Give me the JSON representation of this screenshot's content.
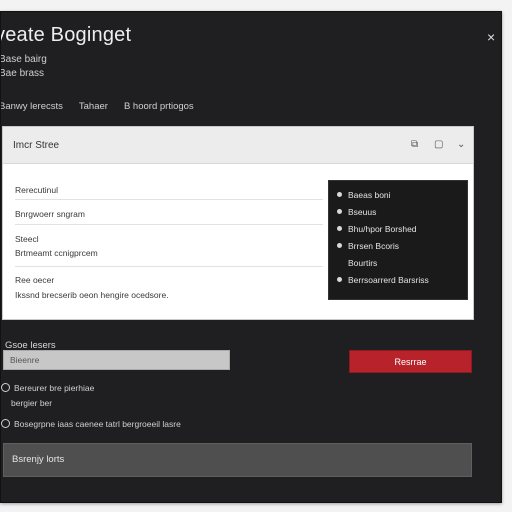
{
  "dialog": {
    "title": "veate Boginget",
    "subtitle_1": "Base bairg",
    "subtitle_2": "Bae brass",
    "close_glyph": "×"
  },
  "tabs": [
    {
      "label": "Banwy lerecsts"
    },
    {
      "label": "Tahaer"
    },
    {
      "label": "B hoord prtiogos"
    }
  ],
  "panel": {
    "title": "Imcr Stree",
    "header_icons": [
      "copy-icon",
      "square-icon",
      "chevron-down-icon"
    ],
    "header_glyphs": [
      "⧉",
      "▢",
      "⌄"
    ],
    "items": [
      {
        "text": "Rerecutinul"
      },
      {
        "text": "Bnrgwoerr sngram"
      },
      {
        "text": "Steecl"
      },
      {
        "text": "Brtmeamt ccnigprcem"
      },
      {
        "text": "Ree oecer"
      },
      {
        "text": "Ikssnd brecserib oeon hengire ocedsore."
      }
    ],
    "dropdown": [
      {
        "text": "Baeas boni"
      },
      {
        "text": "Bseuus"
      },
      {
        "text": "Bhu/hpor Borshed"
      },
      {
        "text": "Brrsen Bcoris"
      },
      {
        "text": "Bourtirs"
      },
      {
        "text": "Berrsoarrerd Barsriss"
      }
    ]
  },
  "form": {
    "label": "Gsoe lesers",
    "input_value": "Bieenre",
    "input_placeholder": "",
    "primary_button": "Resrrae"
  },
  "options": [
    {
      "text": "Bereurer bre pierhiae"
    },
    {
      "text": "bergier ber"
    },
    {
      "text": "Bosegrpne iaas caenee tatrl bergroeeil lasre"
    }
  ],
  "footer": {
    "label": "Bsrenjy lorts"
  },
  "colors": {
    "window_bg": "#1f1f21",
    "panel_bg": "#ffffff",
    "accent_red": "#b8232b",
    "footer_bar": "#4f4f4f"
  }
}
